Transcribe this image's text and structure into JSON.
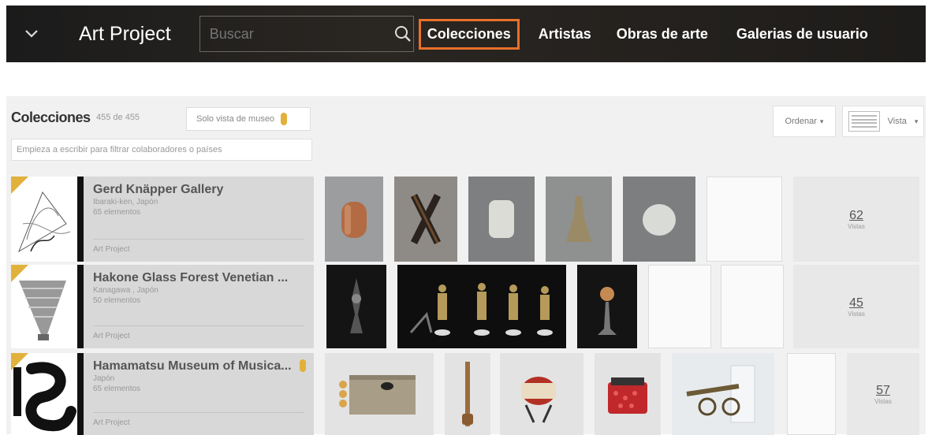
{
  "topbar": {
    "brand": "Art Project",
    "search_placeholder": "Buscar",
    "nav": [
      "Colecciones",
      "Artistas",
      "Obras de arte",
      "Galerias de usuario"
    ],
    "active_nav": "Colecciones",
    "accent_color": "#e8712a"
  },
  "panel": {
    "title": "Colecciones",
    "count": "455 de 455",
    "museum_toggle": "Solo vista de museo",
    "filter_placeholder": "Empieza a escribir para filtrar colaboradores o países",
    "sort_label": "Ordenar",
    "view_label": "Vista"
  },
  "collections": [
    {
      "name": "Gerd Knäpper Gallery",
      "location": "Ibaraki-ken, Japón",
      "items": "65 elementos",
      "source": "Art Project",
      "count": "62",
      "count_label": "Vistas"
    },
    {
      "name": "Hakone Glass Forest Venetian ...",
      "location": "Kanagawa , Japón",
      "items": "50 elementos",
      "source": "Art Project",
      "count": "45",
      "count_label": "Vistas"
    },
    {
      "name": "Hamamatsu Museum of Musica...",
      "location": "Japón",
      "items": "65 elementos",
      "source": "Art Project",
      "count": "57",
      "count_label": "Vistas"
    }
  ],
  "icons": {
    "menu": "chevron-down-icon",
    "search": "search-icon",
    "museum": "pin-icon",
    "view": "list-view-icon"
  }
}
